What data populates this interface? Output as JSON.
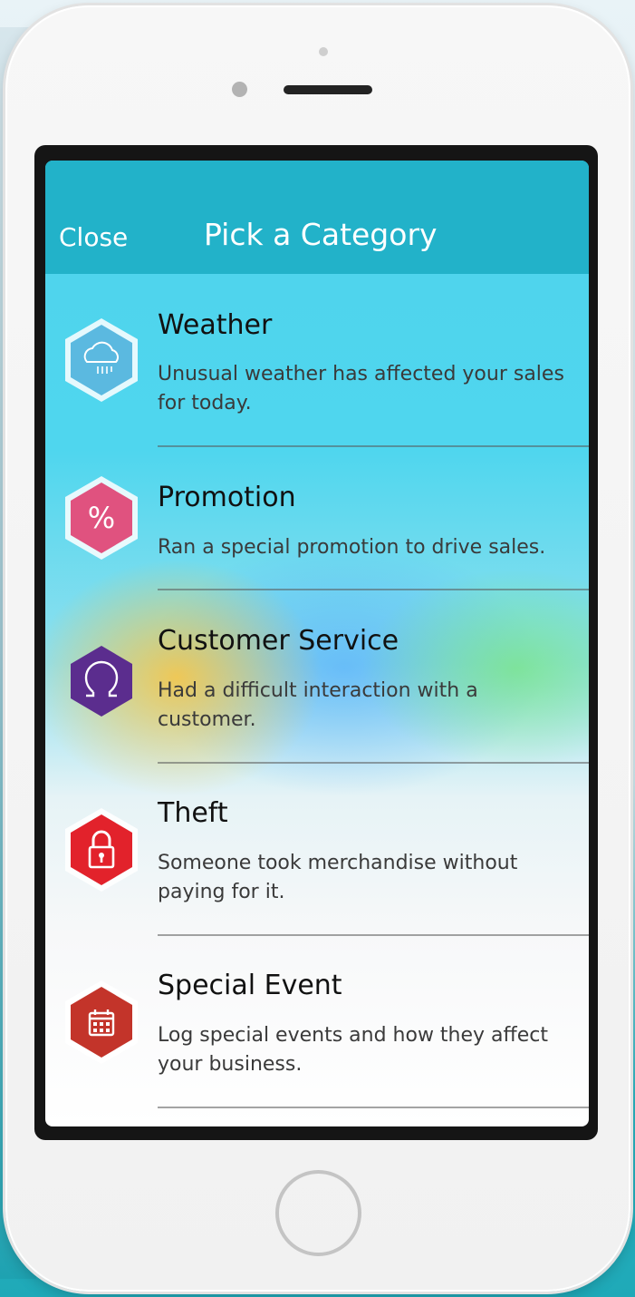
{
  "header": {
    "close_label": "Close",
    "title": "Pick a Category"
  },
  "categories": [
    {
      "title": "Weather",
      "description": "Unusual weather has affected your sales for today.",
      "icon": "cloud-rain-icon",
      "color": "#5bb9e0"
    },
    {
      "title": "Promotion",
      "description": "Ran a special promotion to drive sales.",
      "icon": "percent-icon",
      "color": "#e0527f"
    },
    {
      "title": "Customer Service",
      "description": "Had a difficult interaction with a customer.",
      "icon": "person-icon",
      "color": "#5b2d8e"
    },
    {
      "title": "Theft",
      "description": "Someone took merchandise without paying for it.",
      "icon": "lock-icon",
      "color": "#e2222b"
    },
    {
      "title": "Special Event",
      "description": "Log special events and how they affect your business.",
      "icon": "calendar-icon",
      "color": "#c3342a"
    }
  ]
}
